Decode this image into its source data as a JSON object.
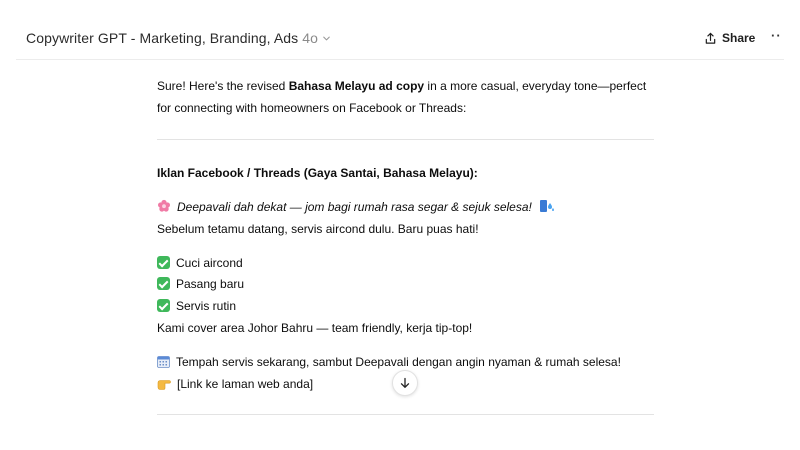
{
  "header": {
    "title": "Copywriter GPT - Marketing, Branding, Ads",
    "model": "4o",
    "share_label": "Share",
    "more_label": "··"
  },
  "message": {
    "intro_part1": "Sure! Here's the revised ",
    "intro_bold": "Bahasa Melayu ad copy",
    "intro_part2": " in a more casual, everyday tone—perfect",
    "intro_line2": "for connecting with homeowners on Facebook or Threads:",
    "section_heading": "Iklan Facebook / Threads (Gaya Santai, Bahasa Melayu):",
    "headline_italic": "Deepavali dah dekat — jom bagi rumah rasa segar & sejuk selesa!",
    "subline": "Sebelum tetamu datang, servis aircond dulu. Baru puas hati!",
    "services": [
      "Cuci aircond",
      "Pasang baru",
      "Servis rutin"
    ],
    "coverage": "Kami cover area Johor Bahru — team friendly, kerja tip-top!",
    "cta": "Tempah servis sekarang, sambut Deepavali dengan angin nyaman & rumah selesa!",
    "link": "[Link ke laman web anda]"
  },
  "icons": {
    "headline_emoji": "flower-icon",
    "headline_trailing_emoji": "droplets-icon",
    "service_emoji": "check-mark-button-icon",
    "cta_emoji": "calendar-icon",
    "link_emoji": "pointing-hand-icon",
    "scroll_button": "arrow-down-icon"
  }
}
